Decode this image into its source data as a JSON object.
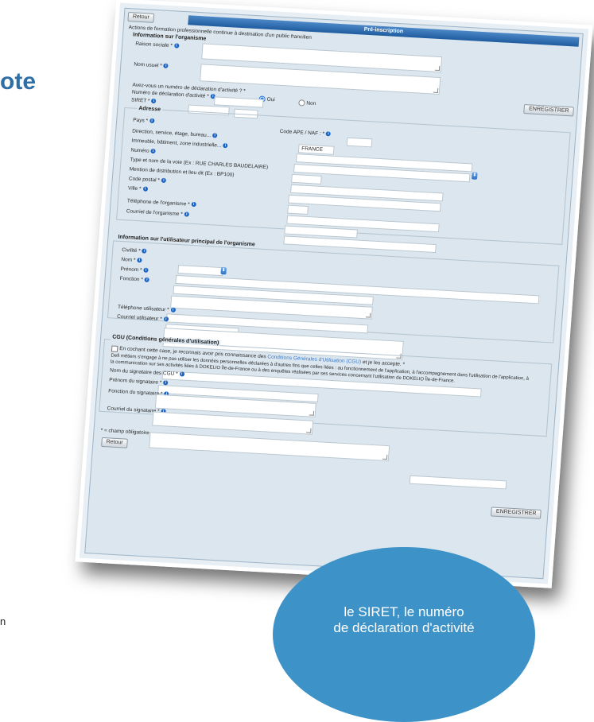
{
  "background": {
    "title_fragment": "ote",
    "text_fragment": "n"
  },
  "form": {
    "title": "Pré-inscription",
    "retour_top": "Retour",
    "retour_bottom": "Retour",
    "enregistrer_top": "ENREGISTRER",
    "enregistrer_bottom": "ENREGISTRER",
    "intro": "Actions de formation professionnelle continue à destination d'un public francilien",
    "org_section": "Information sur l'organisme",
    "raison_sociale": "Raison sociale *",
    "nom_usuel": "Nom usuel *",
    "declaration_question": "Avez-vous un numéro de déclaration d'activité ? *",
    "numero_declaration": "Numéro de déclaration d'activité *",
    "oui": "Oui",
    "non": "Non",
    "siret": "SIRET *",
    "code_ape": "Code APE / NAF : *",
    "adresse_section": "Adresse",
    "pays": "Pays *",
    "pays_value": "FRANCE",
    "direction": "Direction, service, étage, bureau...",
    "immeuble": "Immeuble, bâtiment, zone industrielle...",
    "numero": "Numéro",
    "type_voie": "Type et nom de la voie (Ex : RUE CHARLES BAUDELAIRE)",
    "mention": "Mention de distribution et lieu dit (Ex : BP100)",
    "code_postal": "Code postal *",
    "ville": "Ville *",
    "telephone_org": "Téléphone de l'organisme *",
    "courriel_org": "Courriel de l'organisme *",
    "user_section": "Information sur l'utilisateur principal de l'organisme",
    "civilite": "Civilité *",
    "nom": "Nom *",
    "prenom": "Prénom *",
    "fonction": "Fonction *",
    "telephone_user": "Téléphone utilisateur *",
    "courriel_user": "Courriel utilisateur *",
    "cgu_section": "CGU (Conditions générales d'utilisation)",
    "cgu_text_1": "En cochant cette case, je reconnais avoir pris connaissance des",
    "cgu_link": "Conditions Générales d'Utilisation (CGU)",
    "cgu_text_2": "et je les accepte. *",
    "cgu_para_1": "Defi métiers s'engage à ne pas utiliser les données personnelles déclarées à d'autres fins que celles liées : au fonctionnement de l'application, à l'accompagnement dans l'utilisation de l'application, à",
    "cgu_para_2": "la communication sur ses activités liées à DOKELIO Île-de-France ou à des enquêtes réalisées par ses services concernant l'utilisation de DOKELIO Île-de-France.",
    "nom_signataire": "Nom du signataire des CGU *",
    "prenom_signataire": "Prénom du signataire *",
    "fonction_signataire": "Fonction du signataire *",
    "courriel_signataire": "Courriel du signataire *",
    "mandatory_note": "* = champ obligatoire"
  },
  "callout": {
    "line1": "le SIRET, le numéro",
    "line2": "de déclaration d'activité"
  },
  "colors": {
    "accent": "#2e6fa8",
    "titlebar": "#1f5c9f",
    "callout": "#3d92c7",
    "form_bg": "#dbe6ee"
  },
  "icons": [
    "info-icon",
    "select-arrow-icon",
    "textarea-resize-icon"
  ]
}
